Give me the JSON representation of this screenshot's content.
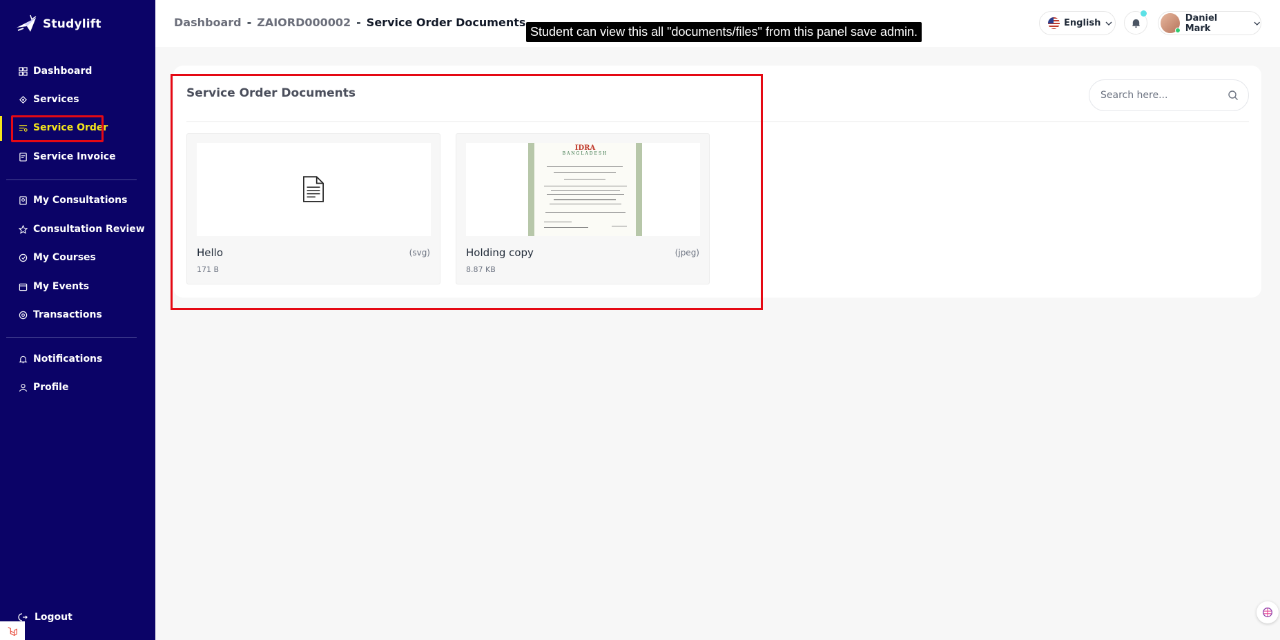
{
  "brand": {
    "name": "Studylift"
  },
  "sidebar": {
    "items": [
      {
        "label": "Dashboard",
        "icon": "dashboard-icon"
      },
      {
        "label": "Services",
        "icon": "services-icon"
      },
      {
        "label": "Service Order",
        "icon": "service-order-icon",
        "active": true
      },
      {
        "label": "Service Invoice",
        "icon": "invoice-icon"
      },
      {
        "label": "My Consultations",
        "icon": "consultation-icon"
      },
      {
        "label": "Consultation Review",
        "icon": "star-icon"
      },
      {
        "label": "My Courses",
        "icon": "courses-icon"
      },
      {
        "label": "My Events",
        "icon": "calendar-icon"
      },
      {
        "label": "Transactions",
        "icon": "transactions-icon"
      },
      {
        "label": "Notifications",
        "icon": "bell-icon"
      },
      {
        "label": "Profile",
        "icon": "user-icon"
      }
    ],
    "logout": "Logout"
  },
  "header": {
    "breadcrumb": {
      "home": "Dashboard",
      "sep": "-",
      "order": "ZAIORD000002",
      "current": "Service Order Documents"
    },
    "annotation": "Student can view this all \"documents/files\" from this panel save admin.",
    "language": "English",
    "user_name": "Daniel Mark"
  },
  "main": {
    "title": "Service Order Documents",
    "search_placeholder": "Search here...",
    "documents": [
      {
        "name": "Hello",
        "ext": "(svg)",
        "size": "171 B",
        "thumb": "file-icon"
      },
      {
        "name": "Holding copy",
        "ext": "(jpeg)",
        "size": "8.87 KB",
        "thumb": "certificate-image"
      }
    ],
    "certificate": {
      "title": "IDRA",
      "subtitle": "BANGLADESH"
    }
  },
  "colors": {
    "sidebar_bg": "#0b0367",
    "active": "#f5e61b",
    "highlight": "#e50914"
  }
}
